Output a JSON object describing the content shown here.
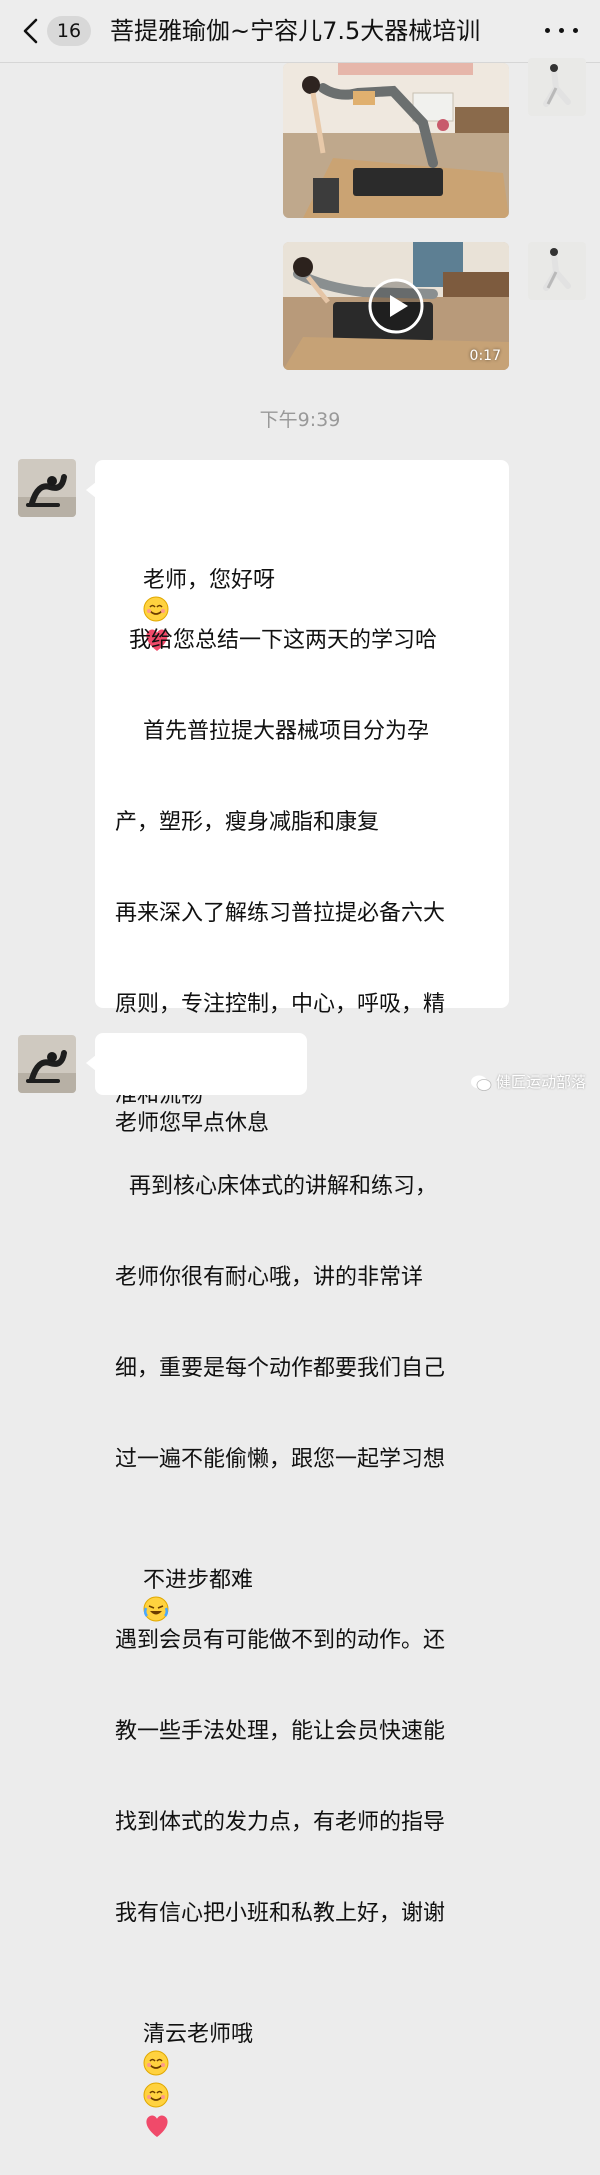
{
  "header": {
    "unread_count": "16",
    "chat_title": "菩提雅瑜伽~宁容儿7.5大器械培训",
    "back_icon": "chevron-left-icon",
    "more_icon": "more-dots-icon"
  },
  "messages": {
    "video_duration": "0:17",
    "timestamp": "下午9:39",
    "long_text_lines": [
      "老师，您好呀",
      "  我给您总结一下这两天的学习哈",
      "    首先普拉提大器械项目分为孕",
      "产，塑形，瘦身减脂和康复",
      "再来深入了解练习普拉提必备六大",
      "原则，专注控制，中心，呼吸，精",
      "准和流畅",
      "  再到核心床体式的讲解和练习，",
      "老师你很有耐心哦，讲的非常详",
      "细，重要是每个动作都要我们自己",
      "过一遍不能偷懒，跟您一起学习想",
      "不进步都难",
      "遇到会员有可能做不到的动作。还",
      "教一些手法处理，能让会员快速能",
      "找到体式的发力点，有老师的指导",
      "我有信心把小班和私教上好，谢谢",
      "清云老师哦"
    ],
    "short_text": "老师您早点休息"
  },
  "watermark": {
    "text": "健匠运动部落"
  },
  "colors": {
    "background": "#ececec",
    "bubble": "#ffffff",
    "timestamp": "#999999"
  }
}
